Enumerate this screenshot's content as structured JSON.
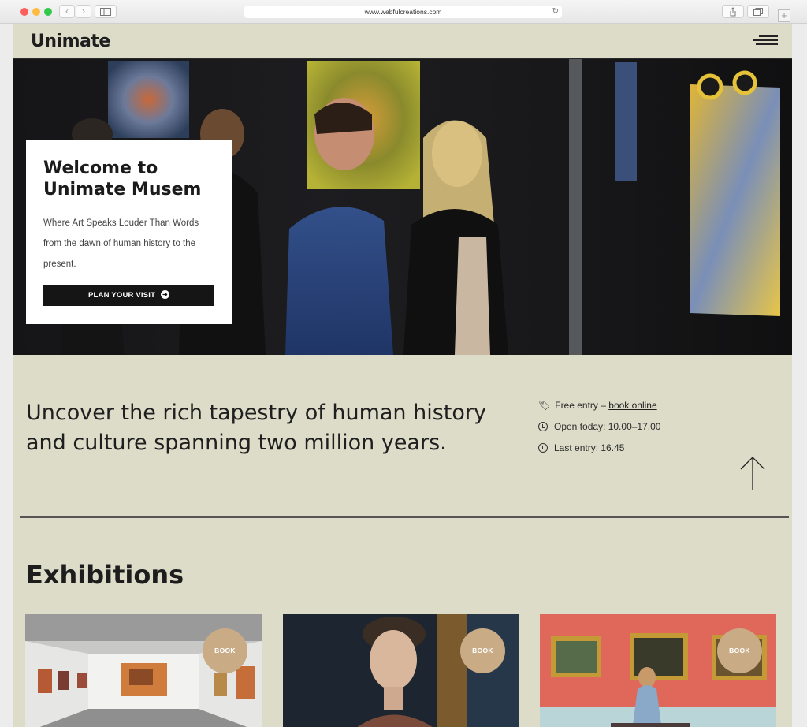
{
  "browser": {
    "url": "www.webfulcreations.com"
  },
  "header": {
    "logo": "Unimate"
  },
  "hero": {
    "title": "Welcome to Unimate Musem",
    "description": "Where Art Speaks Louder Than Words from the dawn of human history to the present.",
    "cta_label": "PLAN YOUR VISIT"
  },
  "info": {
    "tagline": "Uncover the rich tapestry of human history and culture spanning two million years.",
    "entry_prefix": "Free entry – ",
    "entry_link": "book online",
    "open_today": "Open today: 10.00–17.00",
    "last_entry": "Last entry: 16.45"
  },
  "exhibitions": {
    "title": "Exhibitions",
    "cards": [
      {
        "book_label": "BOOK"
      },
      {
        "book_label": "BOOK"
      },
      {
        "book_label": "BOOK"
      }
    ]
  },
  "colors": {
    "page_background": "#dcdcc9",
    "book_badge": "#c9ac86",
    "cta_background": "#151515"
  }
}
